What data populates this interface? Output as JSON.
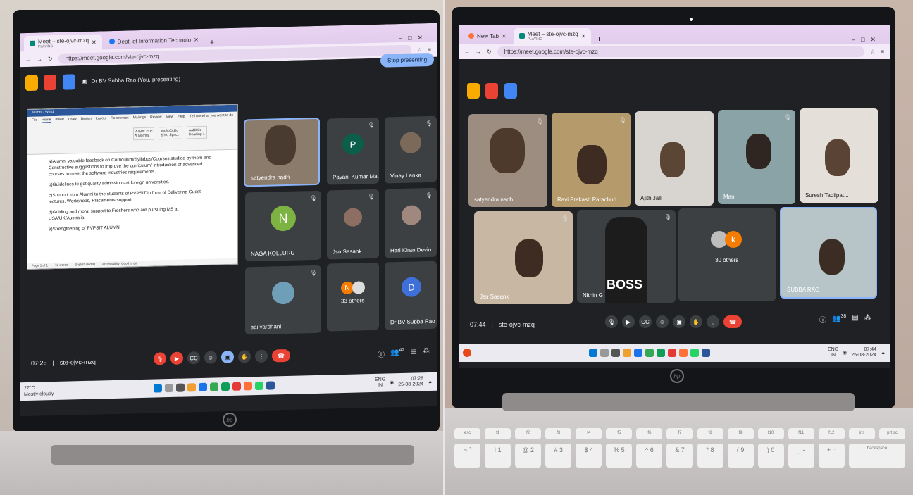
{
  "left": {
    "browser": {
      "tabs": [
        {
          "title": "Meet – ste-ojvc-mzq",
          "sub": "PLAYING"
        },
        {
          "title": "Dept. of Information Technolo",
          "sub": ""
        }
      ],
      "url": "https://meet.google.com/ste-ojvc-mzq"
    },
    "presenting_label": "Dr BV Subba Rao (You, presenting)",
    "stop_button": "Stop presenting",
    "word": {
      "title": "alumni - Word",
      "tabs": [
        "File",
        "Home",
        "Insert",
        "Draw",
        "Design",
        "Layout",
        "References",
        "Mailings",
        "Review",
        "View",
        "Help"
      ],
      "tell_me": "Tell me what you want to do",
      "styles": [
        "AaBbCcDc",
        "AaBbCcDc",
        "AaBbCc"
      ],
      "style_names": [
        "¶ Normal",
        "¶ No Spac...",
        "Heading 1"
      ],
      "paragraphs": [
        "a)Alumni valuable feedback on Curriculum/Syllabus/Courses studied by them and Constructive suggestions to improve the curriculum/ introduction of advanced courses to meet the software industries requirements.",
        "b)Guidelines to get quality admissions at foreign universities.",
        "c)Support from Alumni to the students of PVPSIT in form of Delivering Guest lectures, Workshops, Placements support",
        "d)Guiding and moral support to Freshers who are pursuing MS at USA/UK/Australia.",
        "e)Strengthening of PVPSIT ALUMNI"
      ],
      "status": [
        "Page 1 of 1",
        "72 words",
        "English (India)",
        "Accessibility: Good to go"
      ]
    },
    "tiles": [
      {
        "name": "satyendra nadh",
        "initial": ""
      },
      {
        "name": "Pavani Kumar Ma...",
        "initial": "P"
      },
      {
        "name": "Vinay Lanka",
        "initial": ""
      },
      {
        "name": "NAGA KOLLURU",
        "initial": "N"
      },
      {
        "name": "Jsn Sasank",
        "initial": ""
      },
      {
        "name": "Hari Kiran Devin...",
        "initial": ""
      },
      {
        "name": "sai vardhani",
        "initial": ""
      },
      {
        "name": "33 others",
        "initial": "N"
      },
      {
        "name": "Dr BV Subba Rao",
        "initial": "D"
      }
    ],
    "meeting_time": "07:28",
    "meeting_code": "ste-ojvc-mzq",
    "participant_count": "42",
    "taskbar": {
      "weather_temp": "27°C",
      "weather_text": "Mostly cloudy",
      "lang": "ENG",
      "region": "IN",
      "time": "07:28",
      "date": "25-08-2024"
    },
    "brand": "hp"
  },
  "right": {
    "browser": {
      "tabs": [
        {
          "title": "New Tab",
          "sub": ""
        },
        {
          "title": "Meet – ste-ojvc-mzq",
          "sub": "PLAYING"
        }
      ],
      "url": "https://meet.google.com/ste-ojvc-mzq"
    },
    "tiles": [
      {
        "name": "satyendra nadh"
      },
      {
        "name": "Ravi Prakash Parachuri"
      },
      {
        "name": "Ajith Jalli"
      },
      {
        "name": "Mani"
      },
      {
        "name": "Suresh Tadilpat..."
      },
      {
        "name": "Jsn Sasank"
      },
      {
        "name": "Nithin G"
      },
      {
        "name": "30 others",
        "initial": "k"
      },
      {
        "name": "SUBBA RAO"
      }
    ],
    "shirt_text": "BOSS",
    "meeting_time": "07:44",
    "meeting_code": "ste-ojvc-mzq",
    "participant_count": "38",
    "taskbar": {
      "lang": "ENG",
      "region": "IN",
      "time": "07:44",
      "date": "25-08-2024"
    },
    "brand": "hp",
    "keys_row1": [
      "esc",
      "f1",
      "f2",
      "f3",
      "f4",
      "f5",
      "f6",
      "f7",
      "f8",
      "f9",
      "f10",
      "f11",
      "f12",
      "ins",
      "prt sc"
    ],
    "keys_row2": [
      "~",
      "!",
      "@",
      "#",
      "$",
      "%",
      "^",
      "&",
      "*",
      "(",
      ")",
      "_",
      "+",
      "backspace"
    ],
    "keys_row2_sub": [
      "`",
      "1",
      "2",
      "3",
      "4",
      "5",
      "6",
      "7",
      "8",
      "9",
      "0",
      "-",
      "=",
      ""
    ]
  },
  "colors": {
    "meet_bg": "#202124",
    "tile_bg": "#3c4043",
    "accent_blue": "#8ab4f8",
    "end_call_red": "#ea4335",
    "chrome_purple": "#e2cdee"
  }
}
